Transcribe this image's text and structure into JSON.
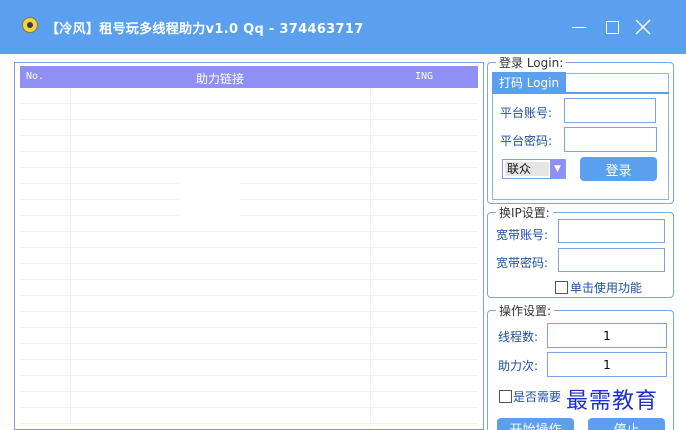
{
  "window": {
    "title": "【冷风】租号玩多线程助力v1.0    Qq - 374463717",
    "colors": {
      "accent": "#5aa0ee",
      "header": "#8f8ff4",
      "label": "#1f4fa0"
    }
  },
  "list": {
    "columns": [
      "No.",
      "助力链接",
      "ING"
    ]
  },
  "login": {
    "legend": "登录 Login:",
    "tab": "打码 Login",
    "account_label": "平台账号:",
    "account_value": "",
    "password_label": "平台密码:",
    "password_value": "",
    "carrier_selected": "联众",
    "login_button": "登录"
  },
  "ip": {
    "legend": "换IP设置:",
    "account_label": "宽带账号:",
    "account_value": "",
    "password_label": "宽带密码:",
    "password_value": "",
    "single_use_label": "单击使用功能"
  },
  "operation": {
    "legend": "操作设置:",
    "threads_label": "线程数:",
    "threads_value": "1",
    "assist_label": "助力次:",
    "assist_value": "1",
    "need_label": "是否需要",
    "start_button": "开始操作",
    "stop_button": "停止"
  },
  "watermark": "最需教育"
}
